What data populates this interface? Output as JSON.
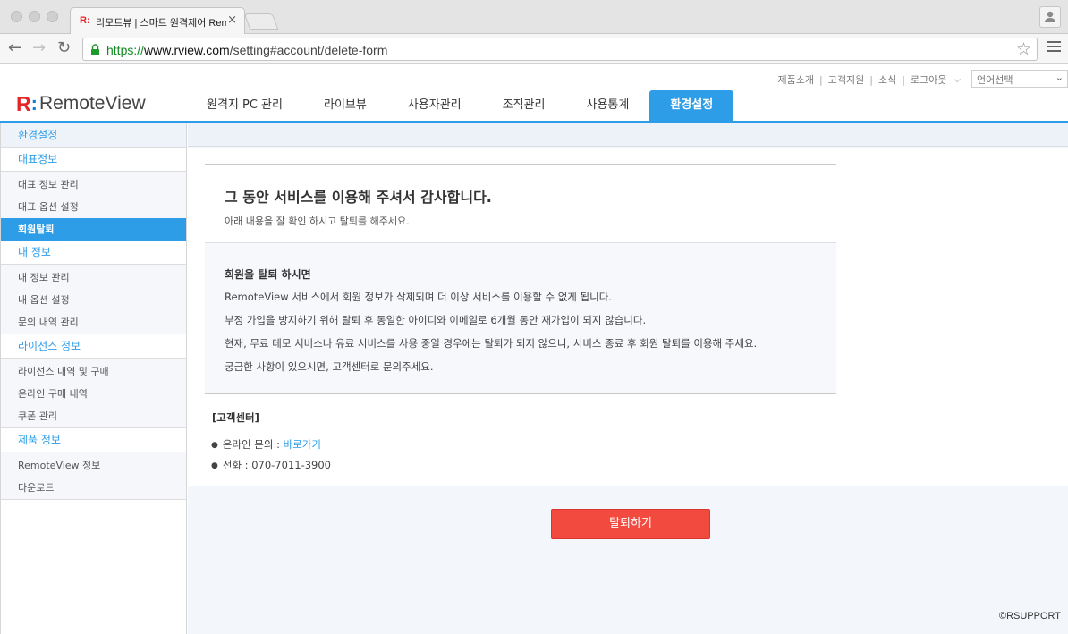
{
  "browser": {
    "tab_favicon": "R:",
    "tab_title": "리모트뷰 | 스마트 원격제어 RemoteView",
    "tab_close": "×",
    "url_scheme": "https://",
    "url_host": "www.rview.com",
    "url_path": "/setting#account/delete-form",
    "back_icon": "←",
    "forward_icon": "→",
    "reload_icon": "↻",
    "star_icon": "☆"
  },
  "header": {
    "logo_mark": "R",
    "logo_colon": ":",
    "logo_text": "RemoteView",
    "util_links": [
      "제품소개",
      "고객지원",
      "소식",
      "로그아웃"
    ],
    "util_sep": "|",
    "util_chevron": "⌵",
    "language_select": "언어선택",
    "language_arrow": "⌄",
    "nav": [
      "원격지 PC 관리",
      "라이브뷰",
      "사용자관리",
      "조직관리",
      "사용통계",
      "환경설정"
    ]
  },
  "sidebar": {
    "top": "환경설정",
    "sections": [
      {
        "title": "대표정보",
        "items": [
          "대표 정보 관리",
          "대표 옵션 설정",
          "회원탈퇴"
        ]
      },
      {
        "title": "내 정보",
        "items": [
          "내 정보 관리",
          "내 옵션 설정",
          "문의 내역 관리"
        ]
      },
      {
        "title": "라이선스 정보",
        "items": [
          "라이선스 내역 및 구매",
          "온라인 구매 내역",
          "쿠폰 관리"
        ]
      },
      {
        "title": "제품 정보",
        "items": [
          "RemoteView 정보",
          "다운로드"
        ]
      }
    ]
  },
  "main": {
    "thanks_title": "그 동안 서비스를 이용해 주셔서 감사합니다.",
    "thanks_sub": "아래 내용을 잘 확인 하시고 탈퇴를 해주세요.",
    "notice_title": "회원을 탈퇴 하시면",
    "notice_lines": [
      "RemoteView 서비스에서 회원 정보가 삭제되며 더 이상 서비스를 이용할 수 없게 됩니다.",
      "부정 가입을 방지하기 위해 탈퇴 후 동일한 아이디와 이메일로 6개월 동안 재가입이 되지 않습니다.",
      "현재, 무료 데모 서비스나 유료 서비스를 사용 중일 경우에는 탈퇴가 되지 않으니, 서비스 종료 후 회원 탈퇴를 이용해 주세요.",
      "궁금한 사항이 있으시면, 고객센터로 문의주세요."
    ],
    "cc_title": "[고객센터]",
    "cc_online_label": "온라인 문의 : ",
    "cc_online_link": "바로가기",
    "cc_phone": "전화 : 070-7011-3900",
    "bullet": "●",
    "withdraw_button": "탈퇴하기",
    "copyright": "©RSUPPORT"
  }
}
